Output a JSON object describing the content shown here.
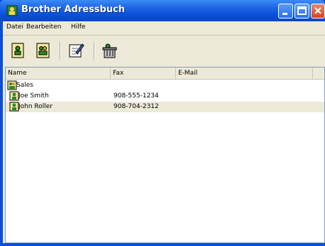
{
  "window": {
    "title": "Brother Adressbuch"
  },
  "menu": {
    "items": [
      "Datei",
      "Bearbeiten",
      "Hilfe"
    ]
  },
  "toolbar": {
    "buttons": [
      {
        "icon": "new-contact-icon"
      },
      {
        "icon": "new-group-icon"
      },
      {
        "icon": "edit-icon"
      },
      {
        "icon": "delete-icon"
      }
    ]
  },
  "list": {
    "columns": [
      "Name",
      "Fax",
      "E-Mail"
    ],
    "rows": [
      {
        "name": "Sales",
        "fax": "",
        "email": "",
        "icon": "group-icon"
      },
      {
        "name": "Joe Smith",
        "fax": "908-555-1234",
        "email": "",
        "icon": "contact-icon"
      },
      {
        "name": "John Roller",
        "fax": "908-704-2312",
        "email": "",
        "icon": "contact-icon",
        "selected": true
      }
    ]
  },
  "colors": {
    "titlebar": "#0a50d8",
    "window_face": "#ece9d8",
    "selection": "#ecead8"
  }
}
